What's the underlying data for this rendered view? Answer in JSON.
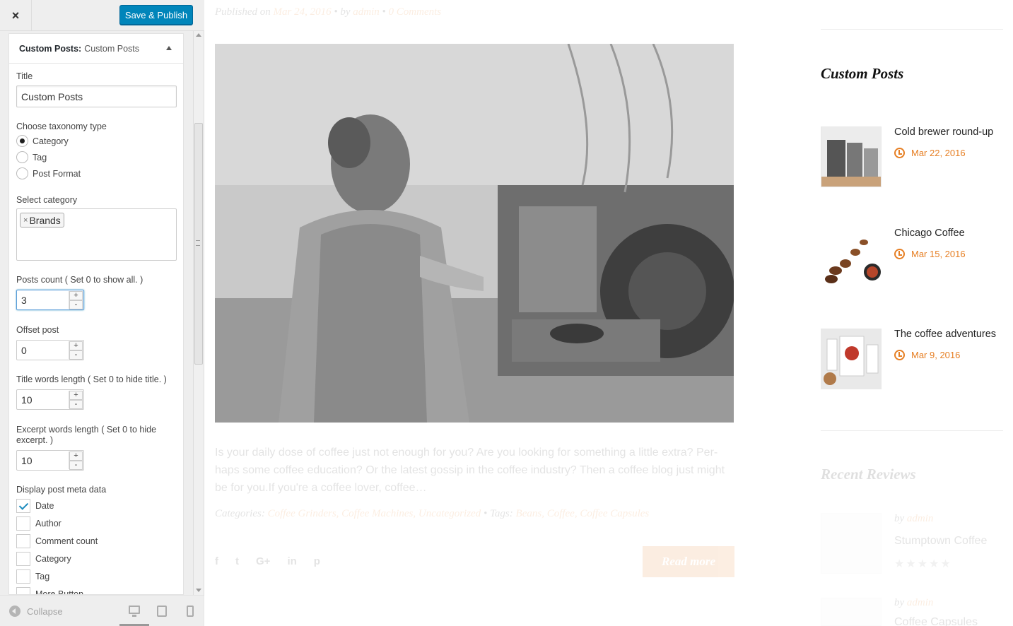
{
  "sidebar": {
    "close_glyph": "×",
    "publish_label": "Save & Publish",
    "panel_title_bold": "Custom Posts:",
    "panel_title_sub": "Custom Posts",
    "title_label": "Title",
    "title_value": "Custom Posts",
    "taxonomy_label": "Choose taxonomy type",
    "taxonomy_options": [
      "Category",
      "Tag",
      "Post Format"
    ],
    "taxonomy_selected": "Category",
    "select_category_label": "Select category",
    "selected_category_chip": "Brands",
    "chip_remove_glyph": "×",
    "posts_count_label": "Posts count ( Set 0 to show all. )",
    "posts_count_value": "3",
    "offset_label": "Offset post",
    "offset_value": "0",
    "title_words_label": "Title words length ( Set 0 to hide title. )",
    "title_words_value": "10",
    "excerpt_words_label_1": "Excerpt words length ( Set 0 to hide",
    "excerpt_words_label_2": "excerpt. )",
    "excerpt_words_value": "10",
    "stepper_plus": "+",
    "stepper_minus": "-",
    "meta_label": "Display post meta data",
    "meta_options": [
      {
        "label": "Date",
        "checked": true
      },
      {
        "label": "Author",
        "checked": false
      },
      {
        "label": "Comment count",
        "checked": false
      },
      {
        "label": "Category",
        "checked": false
      },
      {
        "label": "Tag",
        "checked": false
      },
      {
        "label": "More Button",
        "checked": false
      }
    ],
    "collapse_label": "Collapse",
    "device_icons": [
      "desktop-icon",
      "tablet-icon",
      "mobile-icon"
    ]
  },
  "preview": {
    "meta": {
      "published_on": "Published on",
      "date": "Mar 24, 2016",
      "by": "by",
      "author": "admin",
      "comments": "0 Comments",
      "separator": "•"
    },
    "excerpt": "Is your daily dose of coffee just not enough for you? Are you looking for something a little extra? Per-haps some coffee education? Or the latest gossip in the coffee industry? Then a coffee blog just might be for you.If you're a coffee lover, coffee…",
    "categories_label": "Categories:",
    "categories": "Coffee Grinders, Coffee Machines, Uncategorized",
    "tags_label": "Tags:",
    "tags": "Beans, Coffee, Coffee Capsules",
    "social_glyphs": [
      "f",
      "t",
      "G+",
      "in",
      "p"
    ],
    "read_more": "Read more",
    "widget_custom_posts": {
      "title": "Custom Posts",
      "posts": [
        {
          "title": "Cold brewer round-up",
          "date": "Mar 22, 2016",
          "thumb": "coffee-machine-thumbnail"
        },
        {
          "title": "Chicago Coffee",
          "date": "Mar 15, 2016",
          "thumb": "coffee-beans-thumbnail"
        },
        {
          "title": "The coffee adventures",
          "date": "Mar 9, 2016",
          "thumb": "coffee-package-thumbnail"
        }
      ]
    },
    "widget_recent_reviews": {
      "title": "Recent Reviews",
      "reviews": [
        {
          "by": "by",
          "author": "admin",
          "title": "Stumptown Coffee"
        },
        {
          "by": "by",
          "author": "admin",
          "title": "Coffee Capsules"
        }
      ],
      "stars_glyph": "★★★★★"
    }
  },
  "colors": {
    "accent": "#e67e22",
    "publish_button": "#0085ba",
    "sidebar_bg": "#eeeeee"
  }
}
